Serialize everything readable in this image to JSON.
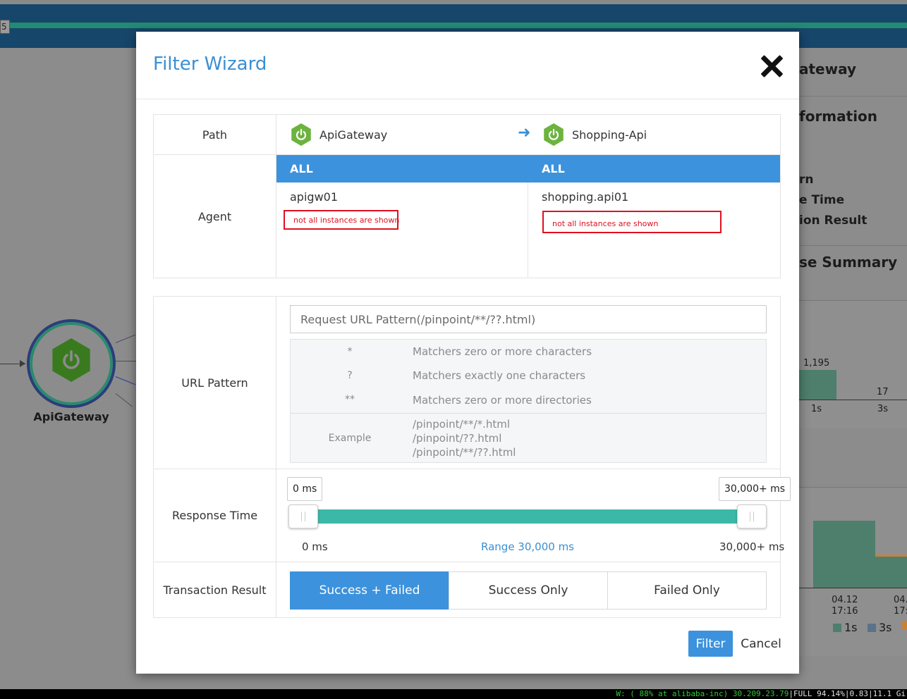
{
  "background": {
    "tab_stub": "5",
    "node_label": "ApiGateway",
    "right_panel": {
      "title_fragment": "ateway",
      "section_information": "formation",
      "items": [
        "rn",
        "e Time",
        "ion Result"
      ],
      "section_summary": "se Summary",
      "chart1": {
        "values": [
          "1,195",
          "17"
        ],
        "ticks": [
          "1s",
          "3s"
        ]
      },
      "chart2": {
        "ticks": [
          "04.12\n17:16",
          "04.\n17:"
        ]
      },
      "legend": [
        "1s",
        "3s"
      ]
    },
    "status_bar": {
      "wifi": "W: ( 88% at alibaba-inc) 30.209.23.79",
      "battery": "FULL 94.14%",
      "load": "0.83",
      "mem": "11.1 Gi"
    }
  },
  "modal": {
    "title": "Filter Wizard",
    "path": {
      "label": "Path",
      "from": "ApiGateway",
      "to": "Shopping-Api"
    },
    "agent": {
      "label": "Agent",
      "from": {
        "selected": "ALL",
        "agent": "apigw01",
        "note": "not all instances are shown"
      },
      "to": {
        "selected": "ALL",
        "agent": "shopping.api01",
        "note": "not all instances are shown"
      }
    },
    "url_pattern": {
      "label": "URL Pattern",
      "placeholder": "Request URL Pattern(/pinpoint/**/??.html)",
      "help": [
        {
          "symbol": "*",
          "desc": "Matchers zero or more characters"
        },
        {
          "symbol": "?",
          "desc": "Matchers exactly one characters"
        },
        {
          "symbol": "**",
          "desc": "Matchers zero or more directories"
        }
      ],
      "example_label": "Example",
      "examples": [
        "/pinpoint/**/*.html",
        "/pinpoint/??.html",
        "/pinpoint/**/??.html"
      ]
    },
    "response_time": {
      "label": "Response Time",
      "min_bubble": "0 ms",
      "max_bubble": "30,000+ ms",
      "min_label": "0 ms",
      "range_label": "Range 30,000 ms",
      "max_label": "30,000+ ms"
    },
    "transaction_result": {
      "label": "Transaction Result",
      "options": [
        "Success + Failed",
        "Success Only",
        "Failed Only"
      ],
      "selected": "Success + Failed"
    },
    "buttons": {
      "filter": "Filter",
      "cancel": "Cancel"
    },
    "colors": {
      "accent": "#3c92dc",
      "slider": "#3bb8a8",
      "warning": "#e0101e",
      "spring": "#6cb33f"
    }
  }
}
